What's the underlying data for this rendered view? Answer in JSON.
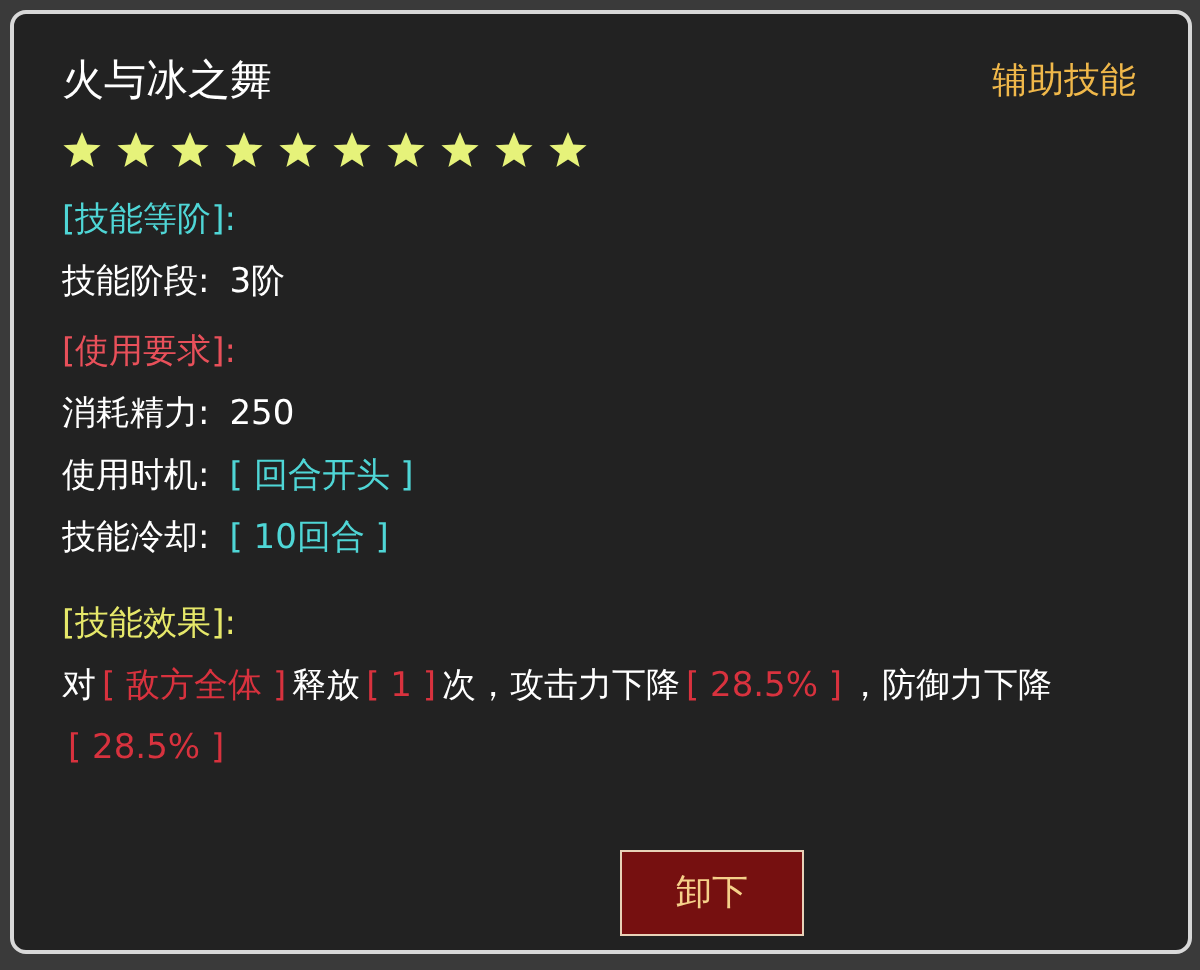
{
  "skill": {
    "title": "火与冰之舞",
    "category": "辅助技能",
    "stars": 10
  },
  "sections": [
    {
      "kind": "level",
      "heading": "[技能等阶]:",
      "lines": [
        {
          "label": "技能阶段:",
          "value": "3阶",
          "kind": "plain"
        }
      ]
    },
    {
      "kind": "requirement",
      "heading": "[使用要求]:",
      "lines": [
        {
          "label": "消耗精力:",
          "value": "250",
          "kind": "plain"
        },
        {
          "label": "使用时机:",
          "value": "[ 回合开头 ]",
          "kind": "bracket"
        },
        {
          "label": "技能冷却:",
          "value": "[ 10回合 ]",
          "kind": "bracket"
        }
      ]
    },
    {
      "kind": "effect",
      "heading": "[技能效果]:",
      "segments": [
        {
          "text": "对",
          "kind": "plain"
        },
        {
          "text": "[ 敌方全体 ]",
          "kind": "highlight"
        },
        {
          "text": "释放",
          "kind": "plain"
        },
        {
          "text": "[ 1 ]",
          "kind": "highlight"
        },
        {
          "text": "次，攻击力下降",
          "kind": "plain"
        },
        {
          "text": "[ 28.5% ]",
          "kind": "highlight"
        },
        {
          "text": "，防御力下降",
          "kind": "plain"
        },
        {
          "text": "[ 28.5% ]",
          "kind": "highlight"
        }
      ]
    }
  ],
  "buttons": [
    {
      "label": "卸下"
    }
  ]
}
